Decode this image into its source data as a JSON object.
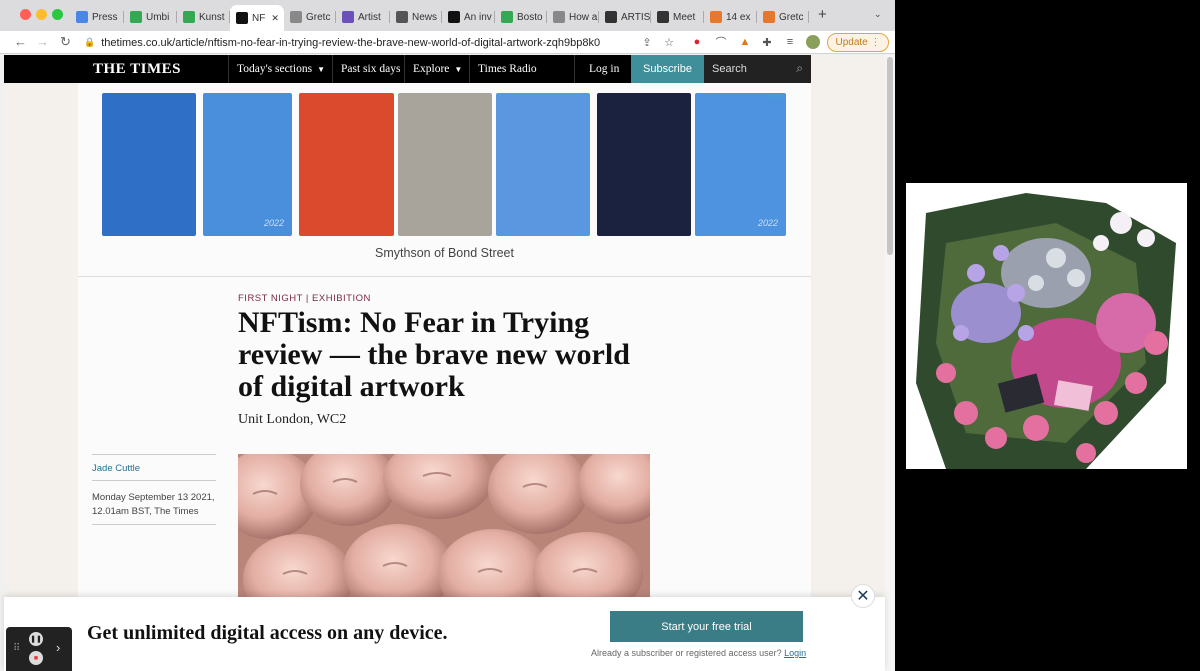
{
  "window": {
    "tabs": [
      {
        "label": "Press",
        "color": "#4a86e8"
      },
      {
        "label": "Umbi",
        "color": "#34a853"
      },
      {
        "label": "Kunst",
        "color": "#34a853"
      },
      {
        "label": "NF",
        "color": "#111111",
        "active": true
      },
      {
        "label": "Gretc",
        "color": "#888888"
      },
      {
        "label": "Artist",
        "color": "#6b4fbb"
      },
      {
        "label": "News",
        "color": "#555555"
      },
      {
        "label": "An inv",
        "color": "#111111"
      },
      {
        "label": "Bosto",
        "color": "#34a853"
      },
      {
        "label": "How a",
        "color": "#888888"
      },
      {
        "label": "ARTIS",
        "color": "#333333"
      },
      {
        "label": "Meet",
        "color": "#333333"
      },
      {
        "label": "14 ex",
        "color": "#e8772e"
      },
      {
        "label": "Gretc",
        "color": "#e8772e"
      }
    ],
    "url": "thetimes.co.uk/article/nftism-no-fear-in-trying-review-the-brave-new-world-of-digital-artwork-zqh9bp8k0",
    "update_label": "Update"
  },
  "masthead": {
    "logo": "THE TIMES",
    "nav": [
      "Today's sections",
      "Past six days",
      "Explore",
      "Times Radio"
    ],
    "login": "Log in",
    "subscribe": "Subscribe",
    "search_placeholder": "Search"
  },
  "ad": {
    "caption": "Smythson of Bond Street",
    "book_colors": [
      "#2f6fc6",
      "#4a8fdb",
      "#dc4a2e",
      "#a8a39b",
      "#5b96e0",
      "#1b2240",
      "#4d93df"
    ],
    "year_label": "2022"
  },
  "article": {
    "kicker": "FIRST NIGHT | EXHIBITION",
    "headline": "NFTism: No Fear in Trying review — the brave new world of digital artwork",
    "venue": "Unit London, WC2",
    "author": "Jade Cuttle",
    "date": "Monday September 13 2021, 12.01am BST, The Times"
  },
  "paywall": {
    "message": "Get unlimited digital access on any device.",
    "cta": "Start your free trial",
    "already": "Already a subscriber or registered access user?",
    "login": "Login"
  }
}
